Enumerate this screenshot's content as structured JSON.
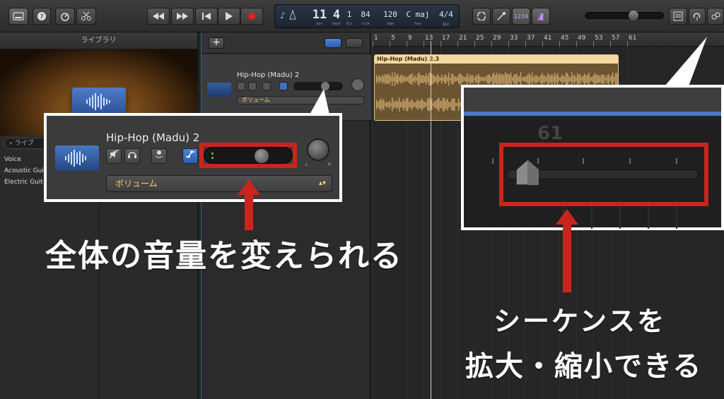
{
  "toolbar": {
    "transport": [
      "rewind",
      "fast-forward",
      "go-to-start",
      "play",
      "record"
    ],
    "lcd": {
      "bar": "11",
      "beat": "4",
      "div": "1",
      "tick": "84",
      "tempo": "120",
      "key": "C maj",
      "time_sig": "4/4",
      "labels": {
        "bar": "bar",
        "beat": "beat",
        "div": "div",
        "tick": "tick",
        "tempo": "bpm",
        "key": "key",
        "sig": "拍子"
      }
    },
    "counter_badge": "1234",
    "master_volume": 0.62
  },
  "library": {
    "title": "ライブラリ",
    "search_placeholder": "ライブ",
    "items": [
      "Voice",
      "Acoustic Gui",
      "Electric Guit"
    ]
  },
  "track": {
    "name": "Hip-Hop (Madu) 2",
    "automation_param": "ボリューム",
    "volume_level": 0.68
  },
  "timeline": {
    "ruler_numbers": [
      "1",
      "5",
      "9",
      "13",
      "17",
      "21",
      "25",
      "29",
      "33",
      "37",
      "41",
      "45",
      "49",
      "53",
      "57",
      "61"
    ],
    "region_name": "Hip-Hop (Madu) 2.3"
  },
  "callout_left": {
    "track_name": "Hip-Hop (Madu) 2",
    "automation_param": "ボリューム",
    "pan_l": "L",
    "pan_r": "R"
  },
  "callout_right": {
    "ruler_label": "61"
  },
  "captions": {
    "volume": "全体の音量を変えられる",
    "zoom_line1": "シーケンスを",
    "zoom_line2": "拡大・縮小できる"
  },
  "colors": {
    "accent_red": "#c8261d",
    "accent_blue": "#4a7cc4",
    "automation_yellow": "#f3d66b",
    "region_header": "#f4d8a0"
  }
}
